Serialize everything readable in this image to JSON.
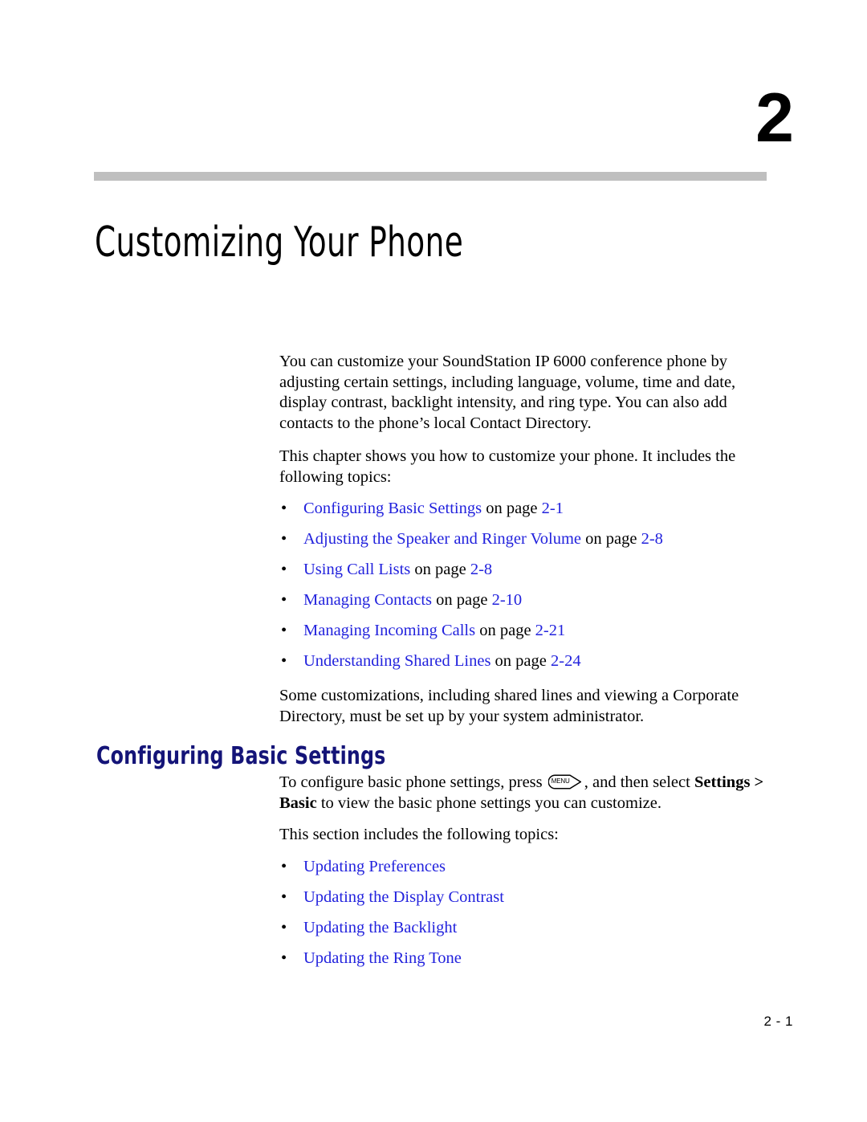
{
  "chapter": {
    "number": "2",
    "title": "Customizing Your Phone"
  },
  "intro": {
    "paragraph_1": "You can customize your SoundStation IP 6000 conference phone by adjusting certain settings, including language, volume, time and date, display contrast, backlight intensity, and ring type. You can also add contacts to the phone’s local Contact Directory.",
    "paragraph_2": "This chapter shows you how to customize your phone. It includes the following topics:"
  },
  "chapter_topics": [
    {
      "link": "Configuring Basic Settings",
      "connector": " on page ",
      "page": "2-1"
    },
    {
      "link": "Adjusting the Speaker and Ringer Volume",
      "connector": " on page ",
      "page": "2-8"
    },
    {
      "link": "Using Call Lists",
      "connector": " on page ",
      "page": "2-8"
    },
    {
      "link": "Managing Contacts",
      "connector": " on page ",
      "page": "2-10"
    },
    {
      "link": "Managing Incoming Calls",
      "connector": " on page ",
      "page": "2-21"
    },
    {
      "link": "Understanding Shared Lines",
      "connector": " on page ",
      "page": "2-24"
    }
  ],
  "note": {
    "paragraph": "Some customizations, including shared lines and viewing a Corporate Directory, must be set up by your system administrator."
  },
  "section": {
    "heading": "Configuring Basic Settings",
    "instruction_before_key": "To configure basic phone settings, press ",
    "key_label": "MENU",
    "key_icon": "menu-key-icon",
    "instruction_after_key": ", and then select ",
    "instruction_bold": "Settings > Basic",
    "instruction_tail": " to view the basic phone settings you can customize.",
    "topics_lead_in": "This section includes the following topics:"
  },
  "section_topics": [
    {
      "link": "Updating Preferences"
    },
    {
      "link": "Updating the Display Contrast"
    },
    {
      "link": "Updating the Backlight"
    },
    {
      "link": "Updating the Ring Tone"
    }
  ],
  "bullet_glyph": "•",
  "footer": {
    "page_number": "2 - 1"
  },
  "colors": {
    "link_blue": "#2222dd",
    "heading_navy": "#141478",
    "rule_gray": "#bfbfbf",
    "body_black": "#000000"
  }
}
